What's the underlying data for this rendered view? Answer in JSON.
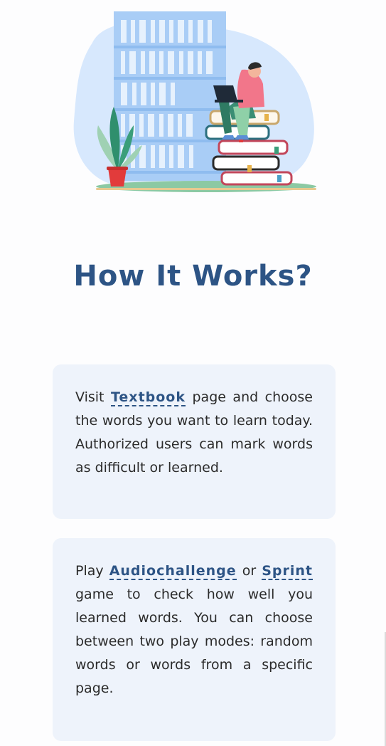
{
  "hero": {
    "illustration": "person-on-books-with-bookshelf"
  },
  "section": {
    "title": "How It Works?"
  },
  "cards": [
    {
      "pre": "Visit ",
      "link": "Textbook",
      "post": " page and choose the words you want to learn today. Authorized users can mark words as difficult or learned."
    },
    {
      "pre": "Play ",
      "link1": "Audiochallenge",
      "mid": " or ",
      "link2": "Sprint",
      "post": " game to check how well you learned words. You can choose between two play modes: random words or words from a specific page."
    }
  ],
  "colors": {
    "accent": "#2d5485",
    "card_bg": "#eef3fb",
    "blob": "#d7e8fd"
  }
}
